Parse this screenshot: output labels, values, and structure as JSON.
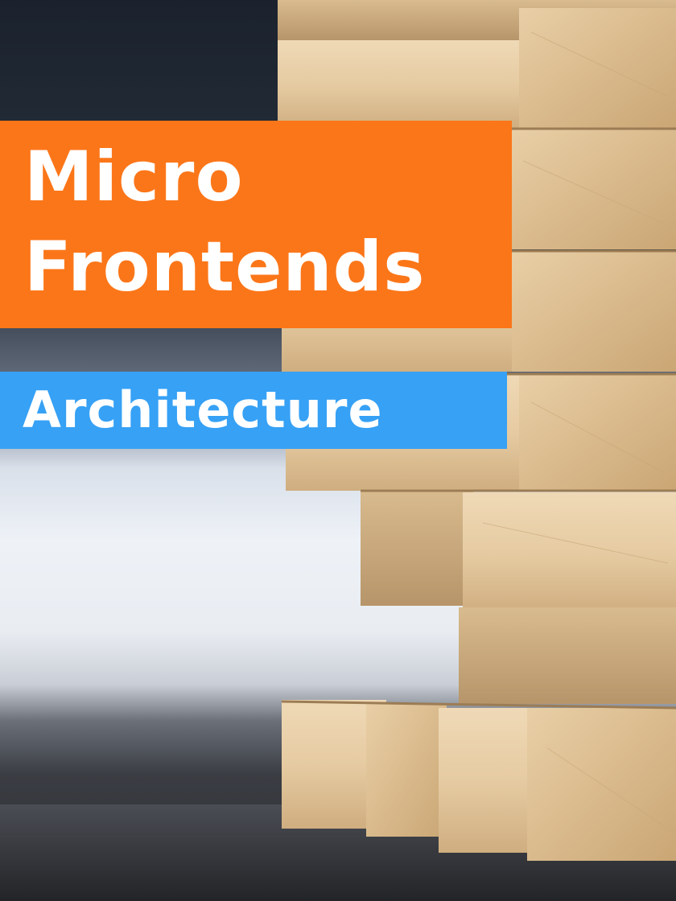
{
  "title": {
    "line1": "Micro",
    "line2": "Frontends",
    "banner_color": "#fb7619"
  },
  "subtitle": {
    "text": "Architecture",
    "banner_color": "#36a1f5"
  },
  "photo": {
    "subject": "wooden-block-tower"
  }
}
